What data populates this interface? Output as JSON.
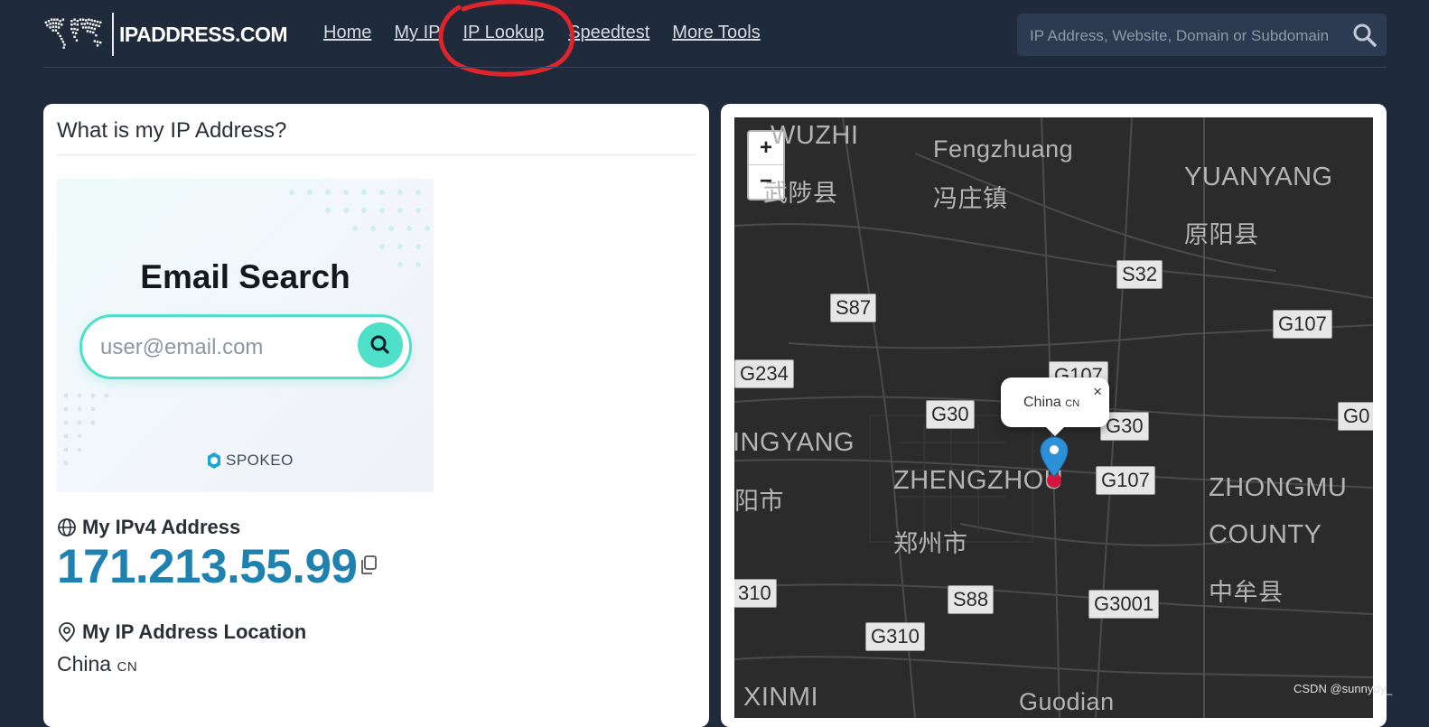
{
  "header": {
    "logo_text": "IPADDRESS.COM",
    "nav": [
      "Home",
      "My IP",
      "IP Lookup",
      "Speedtest",
      "More Tools"
    ],
    "search_placeholder": "IP Address, Website, Domain or Subdomain"
  },
  "left_card": {
    "title": "What is my IP Address?",
    "ad": {
      "title": "Email Search",
      "input_placeholder": "user@email.com",
      "brand": "SPOKEO"
    },
    "ipv4_label": "My IPv4 Address",
    "ipv4_value": "171.213.55.99",
    "location_label": "My IP Address Location",
    "location_country": "China",
    "location_code": "CN"
  },
  "map": {
    "zoom_in": "+",
    "zoom_out": "−",
    "popup_country": "China",
    "popup_code": "CN",
    "popup_close": "×",
    "labels": [
      "WUZHI",
      "武陟县",
      "Fengzhuang",
      "冯庄镇",
      "YUANYANG",
      "原阳县",
      "INGYANG",
      "阳市",
      "ZHENGZHOU",
      "郑州市",
      "ZHONGMU",
      "COUNTY",
      "中牟县",
      "XINMI",
      "Guodian"
    ],
    "shields": [
      "S32",
      "S87",
      "G107",
      "G234",
      "G107",
      "G30",
      "G30",
      "G0",
      "G107",
      "310",
      "S88",
      "G3001",
      "G310"
    ]
  },
  "colors": {
    "ip": "#1e81b0",
    "accent": "#4ee0c9",
    "bg": "#1f2a3b"
  },
  "watermark": "CSDN @sunnydy_"
}
